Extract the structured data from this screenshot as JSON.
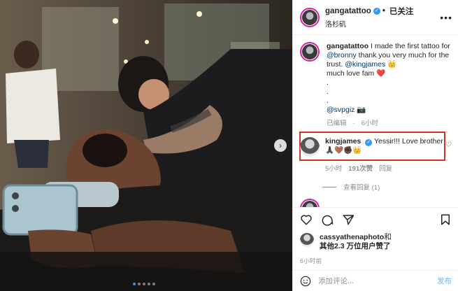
{
  "post": {
    "author": "gangatattoo",
    "follow_state": "已关注",
    "location": "洛杉矶",
    "caption_user": "gangatattoo",
    "caption_parts": {
      "intro": "I made the first tattoo for ",
      "mention1": "@bronny",
      "mid": " thank you very much for the trust. ",
      "mention2": "@kingjames",
      "emoji1": "👑",
      "tail": " much love fam ",
      "emoji2": "❤️",
      "dots": ".",
      "credit": "@svpgiz",
      "camera": "📷"
    },
    "caption_meta": {
      "edited": "已编辑",
      "time": "6小时"
    },
    "top_comment": {
      "user": "kingjames",
      "text": "Yessir!!! Love brother",
      "emojis": "🙏🏿🤎✊🏿👑",
      "time": "5小时",
      "likes": "191次赞",
      "reply": "回复",
      "view_replies": "查看回复 (1)"
    },
    "liked_by": {
      "user": "cassyathenaphoto",
      "rest_a": "和",
      "rest_b": "其他2.3 万位用户赞了"
    },
    "time_ago": "6小时前",
    "add_comment_placeholder": "添加评论...",
    "post_button": "发布",
    "carousel": {
      "total": 5,
      "active": 0
    }
  },
  "colors": {
    "accent_blue": "#3897f0",
    "highlight_red": "#d0312d",
    "mention": "#00376b",
    "meta_gray": "#8e8e8e"
  },
  "icons": [
    "more-icon",
    "heart-icon",
    "comment-icon",
    "share-icon",
    "bookmark-icon",
    "emoji-icon",
    "chevron-right-icon",
    "verified-icon"
  ]
}
